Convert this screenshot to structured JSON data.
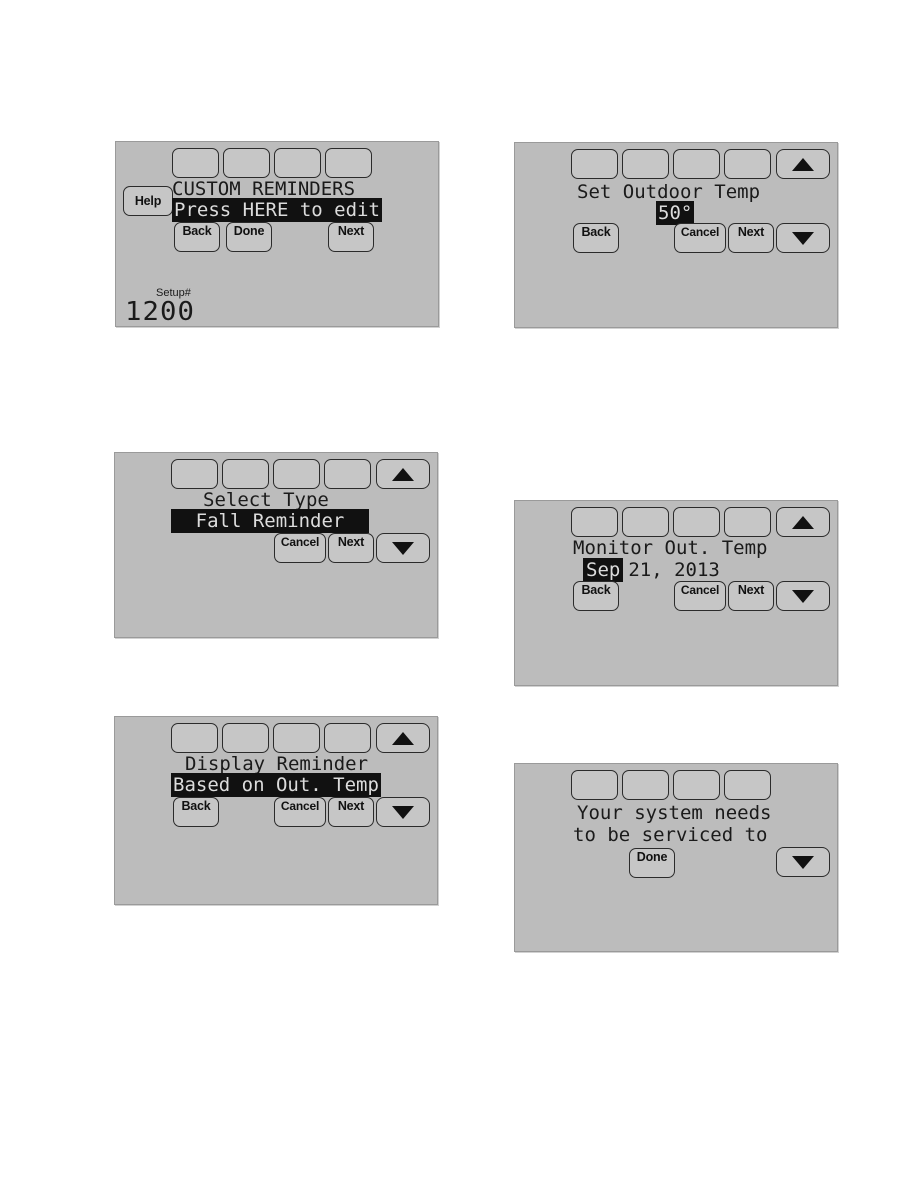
{
  "page": {
    "background_color": "#ffffff",
    "screen_color": "#bcbcbc",
    "button_color": "#c6c6c6",
    "lcd_text_color": "#1a1a1a",
    "highlight_bg": "#111111",
    "highlight_fg": "#dcdcdc"
  },
  "panels": [
    {
      "id": "custom-reminders",
      "title": "CUSTOM REMINDERS",
      "highlight_line": "Press HERE to edit",
      "buttons": {
        "help": "Help",
        "back": "Back",
        "done": "Done",
        "next": "Next"
      },
      "setup": {
        "label": "Setup#",
        "value": "1200"
      }
    },
    {
      "id": "set-outdoor-temp",
      "title": "Set Outdoor Temp",
      "value": "50°",
      "buttons": {
        "back": "Back",
        "cancel": "Cancel",
        "next": "Next"
      },
      "arrows": {
        "up": "up-arrow",
        "down": "down-arrow"
      }
    },
    {
      "id": "select-type",
      "title": "Select Type",
      "highlight_line": "Fall Reminder",
      "buttons": {
        "cancel": "Cancel",
        "next": "Next"
      },
      "arrows": {
        "up": "up-arrow",
        "down": "down-arrow"
      }
    },
    {
      "id": "monitor-out-temp",
      "title": "Monitor Out. Temp",
      "date": {
        "month": "Sep",
        "rest": "21,  2013"
      },
      "buttons": {
        "back": "Back",
        "cancel": "Cancel",
        "next": "Next"
      },
      "arrows": {
        "up": "up-arrow",
        "down": "down-arrow"
      }
    },
    {
      "id": "display-reminder",
      "title": "Display Reminder",
      "highlight_line": "Based on Out. Temp",
      "buttons": {
        "back": "Back",
        "cancel": "Cancel",
        "next": "Next"
      },
      "arrows": {
        "up": "up-arrow",
        "down": "down-arrow"
      }
    },
    {
      "id": "service-message",
      "message_line1": "Your system needs",
      "message_line2": "to be serviced to",
      "buttons": {
        "done": "Done"
      },
      "arrows": {
        "down": "down-arrow"
      }
    }
  ]
}
